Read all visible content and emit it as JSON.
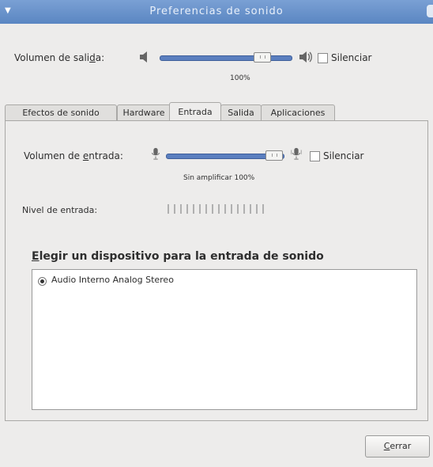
{
  "window": {
    "title": "Preferencias de sonido"
  },
  "output": {
    "label_pre": "Volumen de sali",
    "label_mnemonic": "d",
    "label_post": "a:",
    "value_text": "100%",
    "mute_label": "Silenciar",
    "level_pct": 78
  },
  "tabs": [
    {
      "label": "Efectos de sonido",
      "active": false
    },
    {
      "label": "Hardware",
      "active": false
    },
    {
      "label": "Entrada",
      "active": true
    },
    {
      "label": "Salida",
      "active": false
    },
    {
      "label": "Aplicaciones",
      "active": false
    }
  ],
  "input": {
    "label_pre": "Volumen de ",
    "label_mnemonic": "e",
    "label_post": "ntrada:",
    "value_text": "Sin amplificar  100%",
    "mute_label": "Silenciar",
    "level_pct": 92,
    "level_label": "Nivel de entrada:"
  },
  "device_section": {
    "heading_mnemonic": "E",
    "heading_rest": "legir un dispositivo para la entrada de sonido",
    "devices": [
      {
        "name": "Audio Interno Analog Stereo",
        "selected": true
      }
    ]
  },
  "footer": {
    "close_mnemonic": "C",
    "close_rest": "errar"
  },
  "colors": {
    "titlebar": "#6e96cf",
    "slider": "#5b7fbf",
    "background": "#edeceb"
  }
}
